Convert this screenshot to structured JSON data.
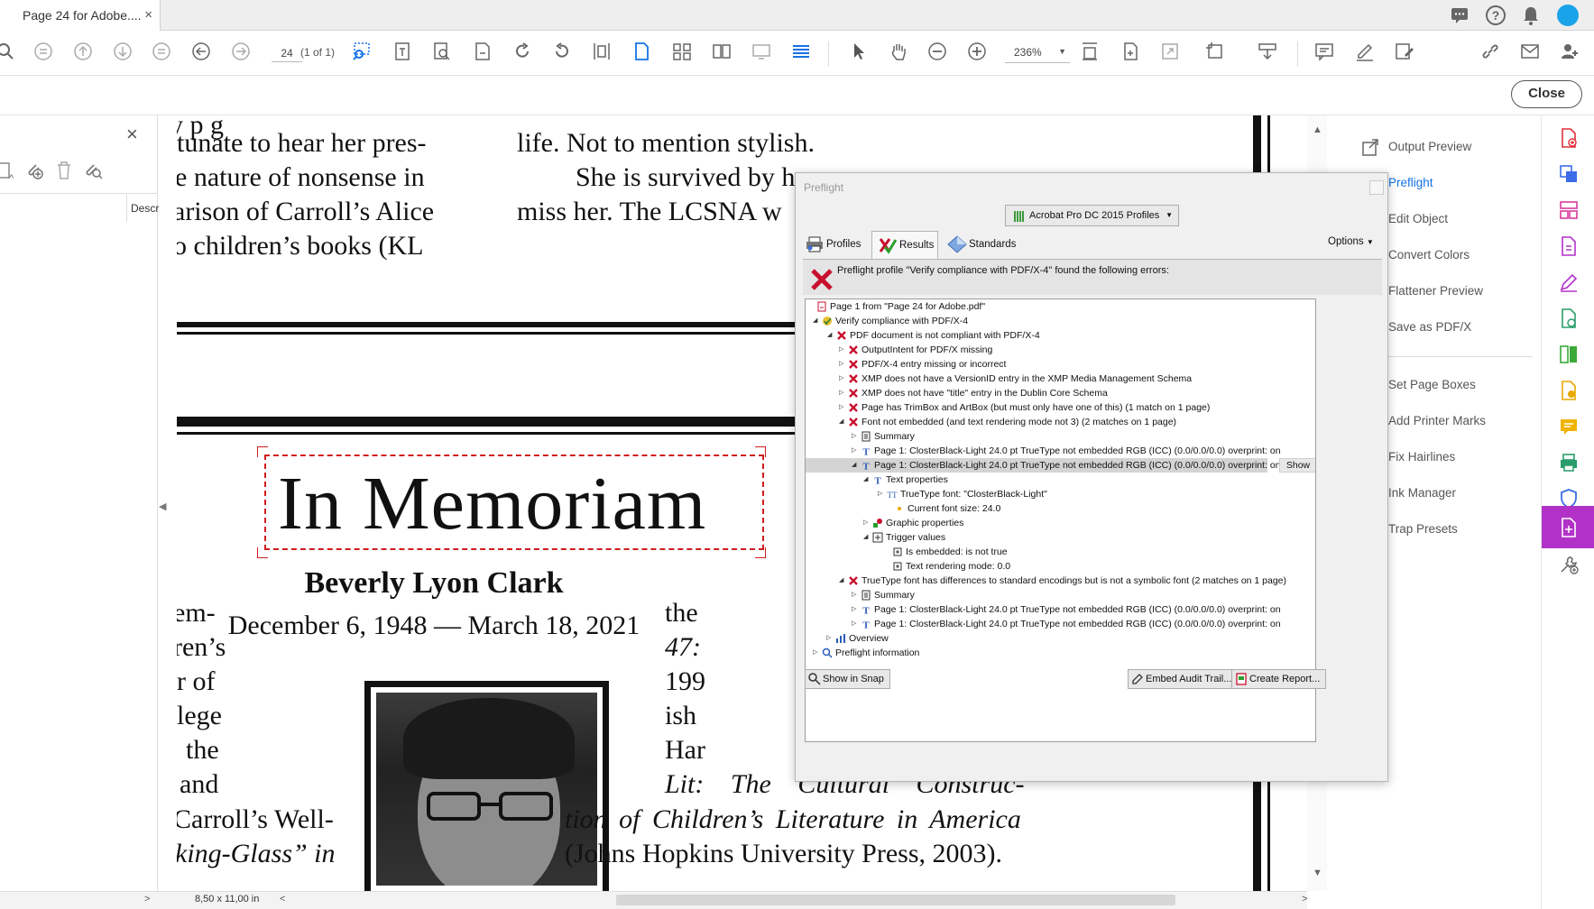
{
  "tab": {
    "title": "Page 24 for Adobe....",
    "close": "×"
  },
  "toolbar": {
    "page_value": "24",
    "page_count": "(1 of 1)",
    "zoom": "236%"
  },
  "close_button": "Close",
  "left_pane": {
    "close": "×",
    "column": "Descr"
  },
  "document": {
    "left_col_top": [
      "tunate to hear her pres-",
      "e nature of nonsense in",
      "arison of Carroll’s Alice",
      "o children’s books (KL"
    ],
    "mid_col_top": [
      "life. Not to mention stylish.",
      "She is survived by h",
      "miss her. The LCSNA w"
    ],
    "heading": "In Memoriam",
    "name": "Beverly Lyon Clark",
    "dates": "December 6, 1948 — March 18, 2021",
    "left_col_bottom": [
      "em-",
      "ren’s",
      "r of",
      "lege",
      "the",
      "and",
      "Carroll’s Well-",
      "king-Glass” in"
    ],
    "right_col_bottom": [
      "the",
      "47:",
      "199",
      "ish",
      "Har",
      "Lit: The Cultural Construc-",
      "tion of Children’s Literature in America",
      "(Johns Hopkins University Press, 2003)."
    ],
    "page_size": "8,50 x 11,00 in"
  },
  "right_pane": {
    "items": [
      "Output Preview",
      "Preflight",
      "Edit Object",
      "Convert Colors",
      "Flattener Preview",
      "Save as PDF/X",
      "Set Page Boxes",
      "Add Printer Marks",
      "Fix Hairlines",
      "Ink Manager",
      "Trap Presets"
    ],
    "active": "Preflight"
  },
  "preflight": {
    "title": "Preflight",
    "profile_select": "Acrobat Pro DC 2015 Profiles",
    "tabs": [
      "Profiles",
      "Results",
      "Standards"
    ],
    "options": "Options",
    "error_header": "Preflight profile \"Verify compliance with PDF/X-4\" found the following errors:",
    "tree": [
      "Page 1 from \"Page 24 for Adobe.pdf\"",
      "Verify compliance with PDF/X-4",
      "PDF document is not compliant with PDF/X-4",
      "OutputIntent for PDF/X missing",
      "PDF/X-4 entry missing or incorrect",
      "XMP does not have a VersionID entry in the XMP Media Management Schema",
      "XMP does not have \"title\" entry in the Dublin Core Schema",
      "Page has TrimBox and ArtBox (but must only have one of this) (1 match on 1 page)",
      "Font not embedded (and text rendering mode not 3) (2 matches on 1 page)",
      "Summary",
      "Page 1: ClosterBlack-Light 24.0 pt TrueType not embedded RGB (ICC) (0.0/0.0/0.0)  overprint: on",
      "Page 1: ClosterBlack-Light 24.0 pt TrueType not embedded RGB (ICC) (0.0/0.0/0.0)  overprint: on",
      "Text properties",
      "TrueType font: \"ClosterBlack-Light\"",
      "Current font size: 24.0",
      "Graphic properties",
      "Trigger values",
      "Is embedded: is not true",
      "Text rendering mode: 0.0",
      "TrueType font has differences to standard encodings but is not a symbolic font (2 matches on 1 page)",
      "Summary",
      "Page 1: ClosterBlack-Light 24.0 pt TrueType not embedded RGB (ICC) (0.0/0.0/0.0)  overprint: on",
      "Page 1: ClosterBlack-Light 24.0 pt TrueType not embedded RGB (ICC) (0.0/0.0/0.0)  overprint: on",
      "Overview",
      "Preflight information"
    ],
    "show": "Show",
    "show_in_snap": "Show in Snap",
    "embed_audit": "Embed Audit Trail...",
    "create_report": "Create Report..."
  },
  "colors": {
    "accent": "#1473e6",
    "selected_tool": "#b232c8",
    "error_red": "#c8102e"
  }
}
